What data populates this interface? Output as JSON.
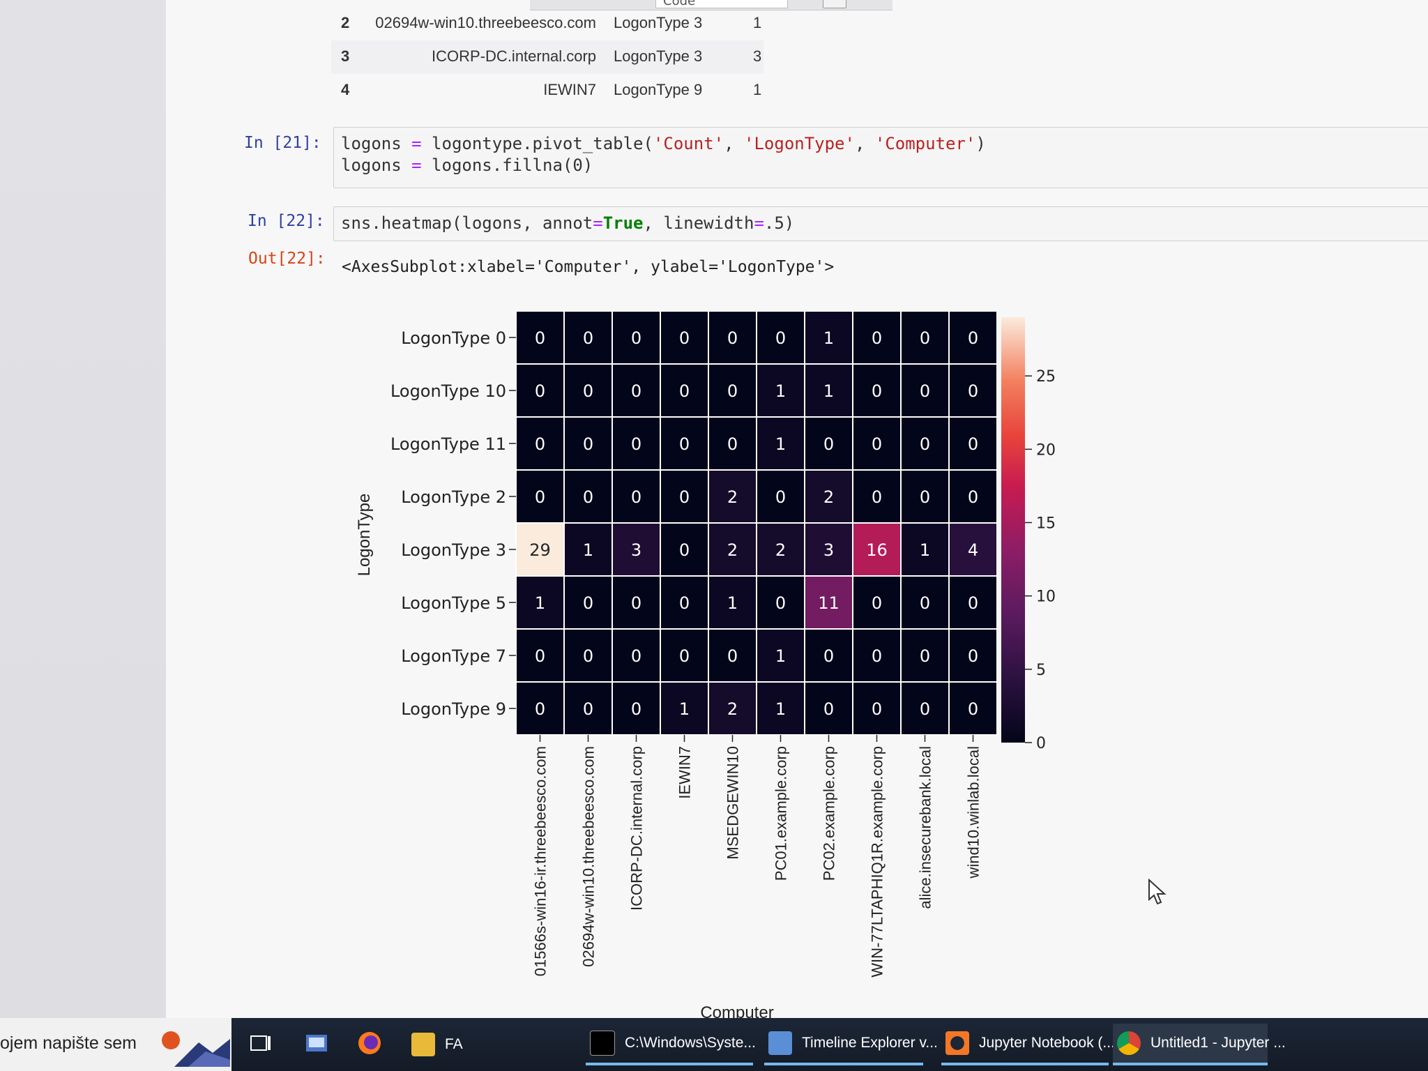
{
  "toolbar": {
    "cell_type": "Code"
  },
  "dataframe_tail": [
    {
      "index": "2",
      "computer": "02694w-win10.threebeesco.com",
      "logon_type": "LogonType 3",
      "count": "1"
    },
    {
      "index": "3",
      "computer": "ICORP-DC.internal.corp",
      "logon_type": "LogonType 3",
      "count": "3"
    },
    {
      "index": "4",
      "computer": "IEWIN7",
      "logon_type": "LogonType 9",
      "count": "1"
    }
  ],
  "cells": {
    "in21_prompt": "In [21]:",
    "in22_prompt": "In [22]:",
    "out22_prompt": "Out[22]:",
    "out22_text": "<AxesSubplot:xlabel='Computer', ylabel='LogonType'>"
  },
  "chart_data": {
    "type": "heatmap",
    "title": "",
    "xlabel": "Computer",
    "ylabel": "LogonType",
    "rows": [
      "LogonType 0",
      "LogonType 10",
      "LogonType 11",
      "LogonType 2",
      "LogonType 3",
      "LogonType 5",
      "LogonType 7",
      "LogonType 9"
    ],
    "columns": [
      "01566s-win16-ir.threebeesco.com",
      "02694w-win10.threebeesco.com",
      "ICORP-DC.internal.corp",
      "IEWIN7",
      "MSEDGEWIN10",
      "PC01.example.corp",
      "PC02.example.corp",
      "WIN-77LTAPHIQ1R.example.corp",
      "alice.insecurebank.local",
      "wind10.winlab.local"
    ],
    "values": [
      [
        0,
        0,
        0,
        0,
        0,
        0,
        1,
        0,
        0,
        0
      ],
      [
        0,
        0,
        0,
        0,
        0,
        1,
        1,
        0,
        0,
        0
      ],
      [
        0,
        0,
        0,
        0,
        0,
        1,
        0,
        0,
        0,
        0
      ],
      [
        0,
        0,
        0,
        0,
        2,
        0,
        2,
        0,
        0,
        0
      ],
      [
        29,
        1,
        3,
        0,
        2,
        2,
        3,
        16,
        1,
        4
      ],
      [
        1,
        0,
        0,
        0,
        1,
        0,
        11,
        0,
        0,
        0
      ],
      [
        0,
        0,
        0,
        0,
        0,
        1,
        0,
        0,
        0,
        0
      ],
      [
        0,
        0,
        0,
        1,
        2,
        1,
        0,
        0,
        0,
        0
      ]
    ],
    "colorbar": {
      "min": 0,
      "max": 29,
      "ticks": [
        0,
        5,
        10,
        15,
        20,
        25
      ]
    },
    "colormap": "rocket",
    "annotations": true,
    "grid": true
  },
  "taskbar": {
    "search_text": "ojem napište sem",
    "items": [
      {
        "label": "FA"
      },
      {
        "label": "C:\\Windows\\Syste..."
      },
      {
        "label": "Timeline Explorer v..."
      },
      {
        "label": "Jupyter Notebook (..."
      },
      {
        "label": "Untitled1 - Jupyter ..."
      }
    ]
  }
}
